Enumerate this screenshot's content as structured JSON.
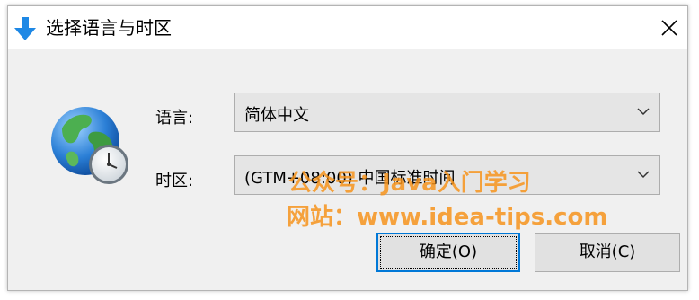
{
  "dialog": {
    "title": "选择语言与时区",
    "title_icon": "download-arrow-icon",
    "close_icon": "close-icon"
  },
  "form": {
    "globe_icon": "globe-clock-icon",
    "language": {
      "label": "语言:",
      "value": "简体中文"
    },
    "timezone": {
      "label": "时区:",
      "value": "(GTM+08:00) 中国标准时间"
    }
  },
  "watermark": {
    "line1": "公众号：Java入门学习",
    "line2": "网站：www.idea-tips.com"
  },
  "buttons": {
    "ok": "确定(O)",
    "cancel": "取消(C)"
  },
  "colors": {
    "accent": "#0078d7",
    "dialog_bg": "#f0f0f0",
    "watermark": "#f7941d"
  }
}
